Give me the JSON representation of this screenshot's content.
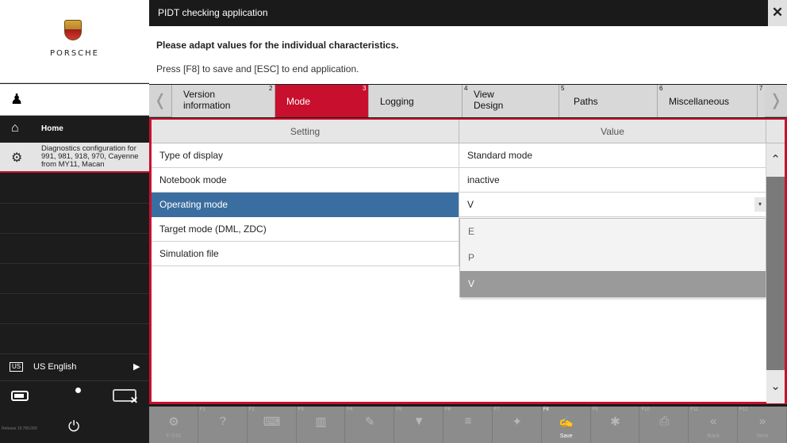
{
  "sidebar": {
    "brand": "PORSCHE",
    "home_label": "Home",
    "diagnostics_label": "Diagnostics configuration for 991, 981, 918, 970, Cayenne from MY11, Macan",
    "language_badge": "US",
    "language_label": "US English",
    "release_label": "Release 19.700.000"
  },
  "window": {
    "title": "PIDT checking application",
    "close_glyph": "✕"
  },
  "instructions": {
    "line1": "Please adapt values for the individual characteristics.",
    "line2": "Press [F8] to save and [ESC] to end application."
  },
  "tabs": [
    {
      "num": "2",
      "label": "Version information",
      "active": false
    },
    {
      "num": "3",
      "label": "Mode",
      "active": true
    },
    {
      "num": "",
      "label": "Logging",
      "active": false
    },
    {
      "num": "4",
      "label": "View Design",
      "active": false
    },
    {
      "num": "5",
      "label": "Paths",
      "active": false
    },
    {
      "num": "6",
      "label": "Miscellaneous",
      "active": false
    },
    {
      "num": "7",
      "label": "",
      "active": false
    }
  ],
  "table": {
    "headers": {
      "setting": "Setting",
      "value": "Value"
    },
    "rows": [
      {
        "setting": "Type of display",
        "value": "Standard mode"
      },
      {
        "setting": "Notebook mode",
        "value": "inactive"
      },
      {
        "setting": "Operating mode",
        "value": "V",
        "selected": true
      },
      {
        "setting": "Target mode (DML, ZDC)",
        "value": ""
      },
      {
        "setting": "Simulation file",
        "value": ""
      }
    ],
    "dropdown_options": [
      "E",
      "P",
      "V"
    ],
    "dropdown_highlighted": "V"
  },
  "fkeys": [
    {
      "fn": "",
      "icon": "gear-car-icon",
      "glyph": "⚙",
      "sub": "F-DIS"
    },
    {
      "fn": "F1",
      "icon": "help-icon",
      "glyph": "?",
      "sub": ""
    },
    {
      "fn": "F2",
      "icon": "keyboard-icon",
      "glyph": "⌨",
      "sub": ""
    },
    {
      "fn": "F3",
      "icon": "chart-icon",
      "glyph": "▥",
      "sub": ""
    },
    {
      "fn": "F4",
      "icon": "edit-icon",
      "glyph": "✎",
      "sub": ""
    },
    {
      "fn": "F5",
      "icon": "filter-icon",
      "glyph": "▼",
      "sub": ""
    },
    {
      "fn": "F6",
      "icon": "list-icon",
      "glyph": "≡",
      "sub": ""
    },
    {
      "fn": "F7",
      "icon": "tools-icon",
      "glyph": "✦",
      "sub": ""
    },
    {
      "fn": "F8",
      "icon": "save-icon",
      "glyph": "✍",
      "sub": "Save",
      "enabled": true
    },
    {
      "fn": "F9",
      "icon": "settings-icon",
      "glyph": "✱",
      "sub": ""
    },
    {
      "fn": "F10",
      "icon": "print-icon",
      "glyph": "⎙",
      "sub": ""
    },
    {
      "fn": "F11",
      "icon": "back-icon",
      "glyph": "«",
      "sub": "Back"
    },
    {
      "fn": "F12",
      "icon": "next-icon",
      "glyph": "»",
      "sub": "Next"
    }
  ]
}
